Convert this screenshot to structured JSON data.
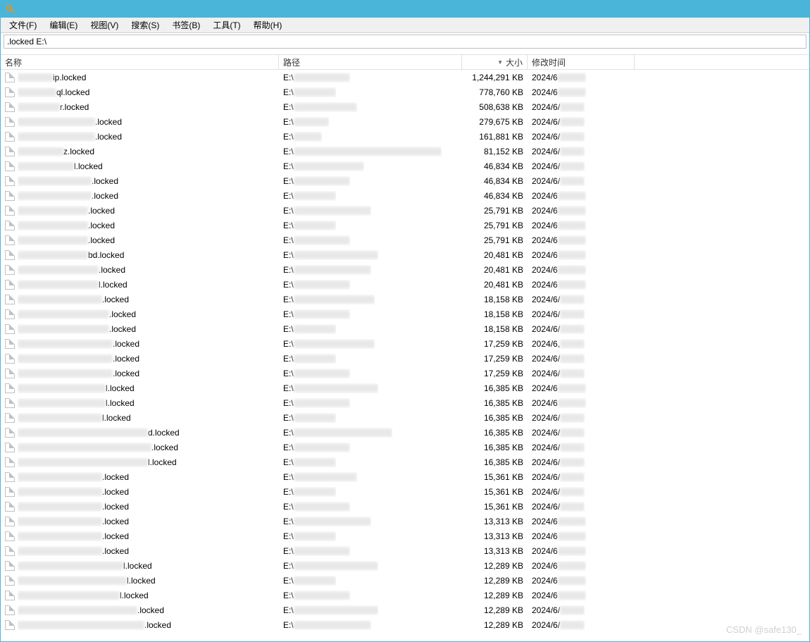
{
  "menubar": {
    "file": "文件(F)",
    "edit": "编辑(E)",
    "view": "视图(V)",
    "search": "搜索(S)",
    "bookmarks": "书签(B)",
    "tools": "工具(T)",
    "help": "帮助(H)"
  },
  "search": {
    "value": ".locked E:\\"
  },
  "columns": {
    "name": "名称",
    "path": "路径",
    "size": "大小",
    "date": "修改时间",
    "sort_indicator": "▼"
  },
  "rows": [
    {
      "name_suffix": "ip.locked",
      "name_blur_w": 50,
      "path_prefix": "E:\\",
      "path_blur_w": 80,
      "size": "1,244,291 KB",
      "date_prefix": "2024/6",
      "date_blur_w": 40
    },
    {
      "name_suffix": "ql.locked",
      "name_blur_w": 55,
      "path_prefix": "E:\\",
      "path_blur_w": 60,
      "size": "778,760 KB",
      "date_prefix": "2024/6",
      "date_blur_w": 40
    },
    {
      "name_suffix": "r.locked",
      "name_blur_w": 60,
      "path_prefix": "E:\\",
      "path_blur_w": 90,
      "size": "508,638 KB",
      "date_prefix": "2024/6/",
      "date_blur_w": 35
    },
    {
      "name_suffix": ".locked",
      "name_blur_w": 110,
      "path_prefix": "E:\\",
      "path_blur_w": 50,
      "size": "279,675 KB",
      "date_prefix": "2024/6/",
      "date_blur_w": 35
    },
    {
      "name_suffix": ".locked",
      "name_blur_w": 110,
      "path_prefix": "E:\\",
      "path_blur_w": 40,
      "size": "161,881 KB",
      "date_prefix": "2024/6/",
      "date_blur_w": 35
    },
    {
      "name_suffix": "z.locked",
      "name_blur_w": 65,
      "path_prefix": "E:\\",
      "path_blur_w": 210,
      "size": "81,152 KB",
      "date_prefix": "2024/6/",
      "date_blur_w": 35
    },
    {
      "name_suffix": "l.locked",
      "name_blur_w": 80,
      "path_prefix": "E:\\",
      "path_blur_w": 100,
      "size": "46,834 KB",
      "date_prefix": "2024/6/",
      "date_blur_w": 35
    },
    {
      "name_suffix": ".locked",
      "name_blur_w": 105,
      "path_prefix": "E:\\",
      "path_blur_w": 80,
      "size": "46,834 KB",
      "date_prefix": "2024/6/",
      "date_blur_w": 35
    },
    {
      "name_suffix": ".locked",
      "name_blur_w": 105,
      "path_prefix": "E:\\",
      "path_blur_w": 60,
      "size": "46,834 KB",
      "date_prefix": "2024/6",
      "date_blur_w": 40
    },
    {
      "name_suffix": ".locked",
      "name_blur_w": 100,
      "path_prefix": "E:\\",
      "path_blur_w": 110,
      "size": "25,791 KB",
      "date_prefix": "2024/6",
      "date_blur_w": 40
    },
    {
      "name_suffix": ".locked",
      "name_blur_w": 100,
      "path_prefix": "E:\\",
      "path_blur_w": 60,
      "size": "25,791 KB",
      "date_prefix": "2024/6",
      "date_blur_w": 40
    },
    {
      "name_suffix": ".locked",
      "name_blur_w": 100,
      "path_prefix": "E:\\",
      "path_blur_w": 80,
      "size": "25,791 KB",
      "date_prefix": "2024/6",
      "date_blur_w": 40
    },
    {
      "name_suffix": "bd.locked",
      "name_blur_w": 100,
      "path_prefix": "E:\\",
      "path_blur_w": 120,
      "size": "20,481 KB",
      "date_prefix": "2024/6",
      "date_blur_w": 40
    },
    {
      "name_suffix": ".locked",
      "name_blur_w": 115,
      "path_prefix": "E:\\",
      "path_blur_w": 110,
      "size": "20,481 KB",
      "date_prefix": "2024/6",
      "date_blur_w": 40
    },
    {
      "name_suffix": "l.locked",
      "name_blur_w": 115,
      "path_prefix": "E:\\",
      "path_blur_w": 80,
      "size": "20,481 KB",
      "date_prefix": "2024/6",
      "date_blur_w": 40
    },
    {
      "name_suffix": ".locked",
      "name_blur_w": 120,
      "path_prefix": "E:\\",
      "path_blur_w": 115,
      "size": "18,158 KB",
      "date_prefix": "2024/6/",
      "date_blur_w": 35
    },
    {
      "name_suffix": ".locked",
      "name_blur_w": 130,
      "path_prefix": "E:\\",
      "path_blur_w": 80,
      "size": "18,158 KB",
      "date_prefix": "2024/6/",
      "date_blur_w": 35
    },
    {
      "name_suffix": ".locked",
      "name_blur_w": 130,
      "path_prefix": "E:\\",
      "path_blur_w": 60,
      "size": "18,158 KB",
      "date_prefix": "2024/6/",
      "date_blur_w": 35
    },
    {
      "name_suffix": ".locked",
      "name_blur_w": 135,
      "path_prefix": "E:\\",
      "path_blur_w": 115,
      "size": "17,259 KB",
      "date_prefix": "2024/6,",
      "date_blur_w": 35
    },
    {
      "name_suffix": ".locked",
      "name_blur_w": 135,
      "path_prefix": "E:\\",
      "path_blur_w": 60,
      "size": "17,259 KB",
      "date_prefix": "2024/6/",
      "date_blur_w": 35
    },
    {
      "name_suffix": ".locked",
      "name_blur_w": 135,
      "path_prefix": "E:\\",
      "path_blur_w": 80,
      "size": "17,259 KB",
      "date_prefix": "2024/6/",
      "date_blur_w": 35
    },
    {
      "name_suffix": "l.locked",
      "name_blur_w": 125,
      "path_prefix": "E:\\",
      "path_blur_w": 120,
      "size": "16,385 KB",
      "date_prefix": "2024/6",
      "date_blur_w": 40
    },
    {
      "name_suffix": "l.locked",
      "name_blur_w": 125,
      "path_prefix": "E:\\",
      "path_blur_w": 80,
      "size": "16,385 KB",
      "date_prefix": "2024/6",
      "date_blur_w": 40
    },
    {
      "name_suffix": "l.locked",
      "name_blur_w": 120,
      "path_prefix": "E:\\",
      "path_blur_w": 60,
      "size": "16,385 KB",
      "date_prefix": "2024/6/",
      "date_blur_w": 35
    },
    {
      "name_suffix": "d.locked",
      "name_blur_w": 185,
      "path_prefix": "E:\\",
      "path_blur_w": 140,
      "size": "16,385 KB",
      "date_prefix": "2024/6/",
      "date_blur_w": 35
    },
    {
      "name_suffix": ".locked",
      "name_blur_w": 190,
      "path_prefix": "E:\\",
      "path_blur_w": 80,
      "size": "16,385 KB",
      "date_prefix": "2024/6/",
      "date_blur_w": 35
    },
    {
      "name_suffix": "l.locked",
      "name_blur_w": 185,
      "path_prefix": "E:\\",
      "path_blur_w": 60,
      "size": "16,385 KB",
      "date_prefix": "2024/6/",
      "date_blur_w": 35
    },
    {
      "name_suffix": ".locked",
      "name_blur_w": 120,
      "path_prefix": "E:\\",
      "path_blur_w": 90,
      "size": "15,361 KB",
      "date_prefix": "2024/6/",
      "date_blur_w": 35
    },
    {
      "name_suffix": ".locked",
      "name_blur_w": 120,
      "path_prefix": "E:\\",
      "path_blur_w": 60,
      "size": "15,361 KB",
      "date_prefix": "2024/6/",
      "date_blur_w": 35
    },
    {
      "name_suffix": ".locked",
      "name_blur_w": 120,
      "path_prefix": "E:\\",
      "path_blur_w": 80,
      "size": "15,361 KB",
      "date_prefix": "2024/6/",
      "date_blur_w": 35
    },
    {
      "name_suffix": ".locked",
      "name_blur_w": 120,
      "path_prefix": "E:\\",
      "path_blur_w": 110,
      "size": "13,313 KB",
      "date_prefix": "2024/6",
      "date_blur_w": 40
    },
    {
      "name_suffix": ".locked",
      "name_blur_w": 120,
      "path_prefix": "E:\\",
      "path_blur_w": 60,
      "size": "13,313 KB",
      "date_prefix": "2024/6",
      "date_blur_w": 40
    },
    {
      "name_suffix": ".locked",
      "name_blur_w": 120,
      "path_prefix": "E:\\",
      "path_blur_w": 80,
      "size": "13,313 KB",
      "date_prefix": "2024/6",
      "date_blur_w": 40
    },
    {
      "name_suffix": "l.locked",
      "name_blur_w": 150,
      "path_prefix": "E:\\",
      "path_blur_w": 120,
      "size": "12,289 KB",
      "date_prefix": "2024/6",
      "date_blur_w": 40
    },
    {
      "name_suffix": "l.locked",
      "name_blur_w": 155,
      "path_prefix": "E:\\",
      "path_blur_w": 60,
      "size": "12,289 KB",
      "date_prefix": "2024/6",
      "date_blur_w": 40
    },
    {
      "name_suffix": "l.locked",
      "name_blur_w": 145,
      "path_prefix": "E:\\",
      "path_blur_w": 80,
      "size": "12,289 KB",
      "date_prefix": "2024/6",
      "date_blur_w": 40
    },
    {
      "name_suffix": ".locked",
      "name_blur_w": 170,
      "path_prefix": "E:\\",
      "path_blur_w": 120,
      "size": "12,289 KB",
      "date_prefix": "2024/6/",
      "date_blur_w": 35
    },
    {
      "name_suffix": ".locked",
      "name_blur_w": 180,
      "path_prefix": "E:\\",
      "path_blur_w": 110,
      "size": "12,289 KB",
      "date_prefix": "2024/6/",
      "date_blur_w": 35
    }
  ],
  "watermark": "CSDN @safe130_"
}
